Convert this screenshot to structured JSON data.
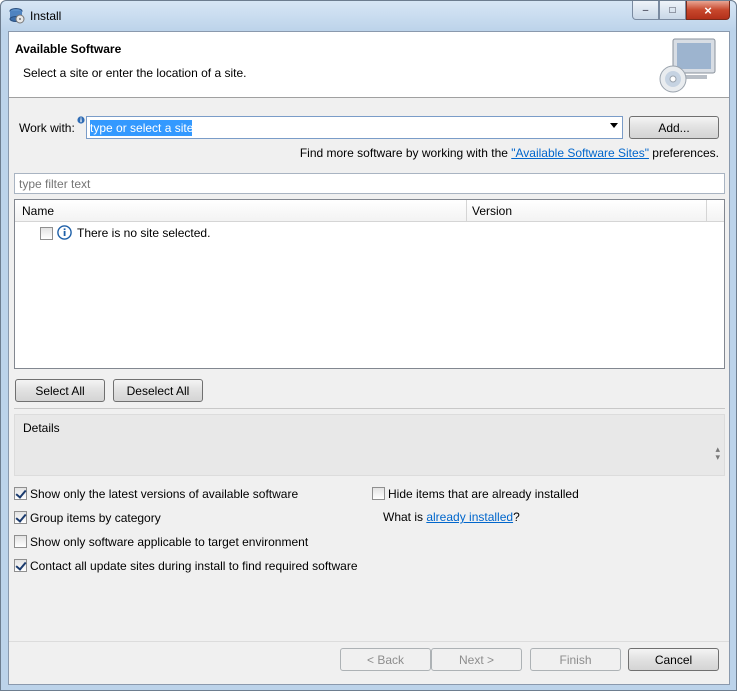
{
  "window": {
    "title": "Install",
    "controls": {
      "minimize": "–",
      "maximize": "□",
      "close": "×"
    }
  },
  "header": {
    "title": "Available Software",
    "subtitle": "Select a site or enter the location of a site.",
    "image": "computer-cd-icon"
  },
  "work_with": {
    "label": "Work with:",
    "value": "type or select a site",
    "add_label": "Add..."
  },
  "find_more": {
    "prefix": "Find more software by working with the ",
    "link": "\"Available Software Sites\"",
    "suffix": " preferences."
  },
  "filter": {
    "placeholder": "type filter text"
  },
  "table": {
    "columns": [
      "Name",
      "Version"
    ],
    "rows": [
      {
        "checked": false,
        "icon": "info-icon",
        "text": "There is no site selected."
      }
    ]
  },
  "selection_buttons": {
    "select_all": "Select All",
    "deselect_all": "Deselect All"
  },
  "details": {
    "label": "Details"
  },
  "options": {
    "latest": {
      "label": "Show only the latest versions of available software",
      "checked": true
    },
    "group": {
      "label": "Group items by category",
      "checked": true
    },
    "applicable": {
      "label": "Show only software applicable to target environment",
      "checked": false
    },
    "contact": {
      "label": "Contact all update sites during install to find required software",
      "checked": true
    },
    "hide_installed": {
      "label": "Hide items that are already installed",
      "checked": false
    },
    "what_is": {
      "prefix": "What is ",
      "link": "already installed",
      "suffix": "?"
    }
  },
  "footer": {
    "back": "< Back",
    "next": "Next >",
    "finish": "Finish",
    "cancel": "Cancel"
  },
  "colors": {
    "selection": "#3399ff",
    "link": "#0066cc",
    "titlebar": "#bcd3ea"
  }
}
